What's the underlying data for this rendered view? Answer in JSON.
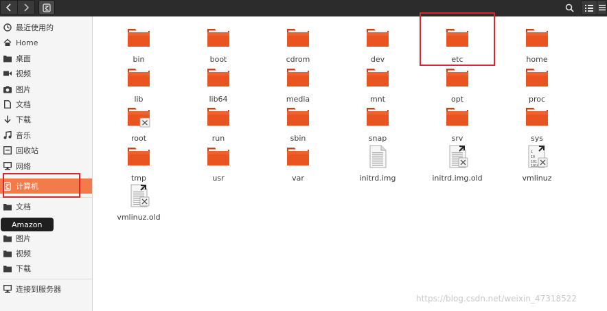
{
  "colors": {
    "accent": "#f37a4a",
    "folder": "#e95420",
    "highlight_box": "#d9262f",
    "headerbar": "#2c2c2c"
  },
  "toolbar": {
    "back_icon": "chevron-left-icon",
    "forward_icon": "chevron-right-icon",
    "location_icon": "computer-icon",
    "search_icon": "search-icon",
    "view_icon": "list-view-icon",
    "menu_icon": "hamburger-menu-icon"
  },
  "sidebar": {
    "items": [
      {
        "label": "最近使用的",
        "icon": "clock-icon"
      },
      {
        "label": "Home",
        "icon": "home-icon"
      },
      {
        "label": "桌面",
        "icon": "folder-icon"
      },
      {
        "label": "视频",
        "icon": "video-icon"
      },
      {
        "label": "图片",
        "icon": "camera-icon"
      },
      {
        "label": "文档",
        "icon": "document-icon"
      },
      {
        "label": "下载",
        "icon": "download-icon"
      },
      {
        "label": "音乐",
        "icon": "music-icon"
      },
      {
        "label": "回收站",
        "icon": "trash-icon"
      },
      {
        "label": "网络",
        "icon": "network-icon"
      },
      {
        "label": "计算机",
        "icon": "computer-icon",
        "active": true
      },
      {
        "label": "文档",
        "icon": "folder-icon"
      },
      {
        "label": "图片",
        "icon": "folder-icon"
      },
      {
        "label": "视频",
        "icon": "folder-icon"
      },
      {
        "label": "下载",
        "icon": "folder-icon"
      },
      {
        "label": "连接到服务器",
        "icon": "server-icon"
      }
    ],
    "tooltip": "Amazon"
  },
  "files": [
    {
      "name": "bin",
      "kind": "folder"
    },
    {
      "name": "boot",
      "kind": "folder"
    },
    {
      "name": "cdrom",
      "kind": "folder"
    },
    {
      "name": "dev",
      "kind": "folder"
    },
    {
      "name": "etc",
      "kind": "folder"
    },
    {
      "name": "home",
      "kind": "folder"
    },
    {
      "name": "lib",
      "kind": "folder"
    },
    {
      "name": "lib64",
      "kind": "folder"
    },
    {
      "name": "media",
      "kind": "folder"
    },
    {
      "name": "mnt",
      "kind": "folder"
    },
    {
      "name": "opt",
      "kind": "folder"
    },
    {
      "name": "proc",
      "kind": "folder"
    },
    {
      "name": "root",
      "kind": "folder-locked"
    },
    {
      "name": "run",
      "kind": "folder"
    },
    {
      "name": "sbin",
      "kind": "folder"
    },
    {
      "name": "snap",
      "kind": "folder"
    },
    {
      "name": "srv",
      "kind": "folder"
    },
    {
      "name": "sys",
      "kind": "folder"
    },
    {
      "name": "tmp",
      "kind": "folder"
    },
    {
      "name": "usr",
      "kind": "folder"
    },
    {
      "name": "var",
      "kind": "folder"
    },
    {
      "name": "initrd.img",
      "kind": "text-file"
    },
    {
      "name": "initrd.img.old",
      "kind": "text-link-broken"
    },
    {
      "name": "vmlinuz",
      "kind": "binary-link-broken"
    },
    {
      "name": "vmlinuz.old",
      "kind": "link-broken"
    }
  ],
  "watermark": "https://blog.csdn.net/weixin_47318522"
}
